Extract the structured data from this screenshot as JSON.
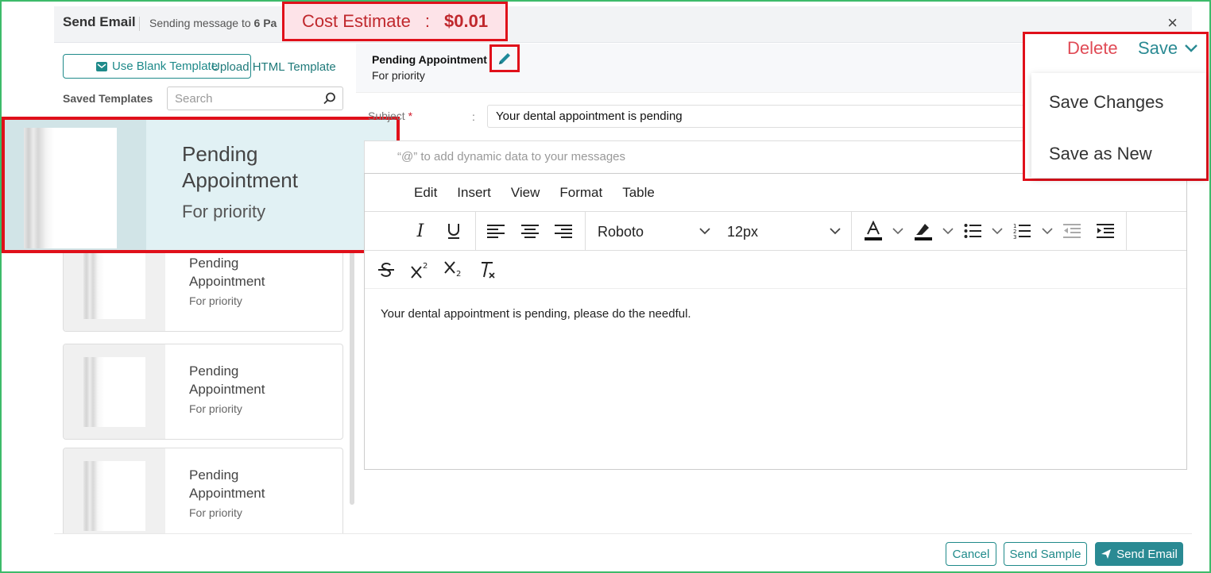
{
  "header": {
    "title": "Send Email",
    "subtitle_prefix": "Sending message to ",
    "subtitle_count": "6 Pa",
    "close": "×"
  },
  "cost": {
    "label": "Cost Estimate",
    "separator": ":",
    "amount": "$0.01"
  },
  "left": {
    "use_blank": "Use Blank Template",
    "upload_html": "Upload HTML Template",
    "saved_label": "Saved Templates",
    "search_placeholder": "Search",
    "selected_card": {
      "title": "Pending Appointment",
      "subtitle": "For priority"
    },
    "cards": [
      {
        "title": "Pending Appointment",
        "subtitle": "For priority"
      },
      {
        "title": "Pending Appointment",
        "subtitle": "For priority"
      },
      {
        "title": "Pending Appointment",
        "subtitle": "For priority"
      }
    ]
  },
  "template": {
    "name": "Pending Appointment",
    "subtitle": "For priority"
  },
  "actions": {
    "delete": "Delete",
    "save": "Save",
    "menu": [
      "Save Changes",
      "Save as New"
    ]
  },
  "form": {
    "subject_label": "Subject",
    "required_mark": "*",
    "colon": ":",
    "subject_value": "Your dental appointment is pending",
    "hint": "“@” to add dynamic data to your messages"
  },
  "editor": {
    "menu": [
      "Edit",
      "Insert",
      "View",
      "Format",
      "Table"
    ],
    "font": "Roboto",
    "size": "12px",
    "content": "Your dental appointment is pending, please do the needful."
  },
  "footer": {
    "cancel": "Cancel",
    "send_sample": "Send Sample",
    "send_email": "Send Email"
  },
  "colors": {
    "accent": "#2a8a93",
    "highlight_border": "#e0101a",
    "delete": "#e04a55"
  }
}
